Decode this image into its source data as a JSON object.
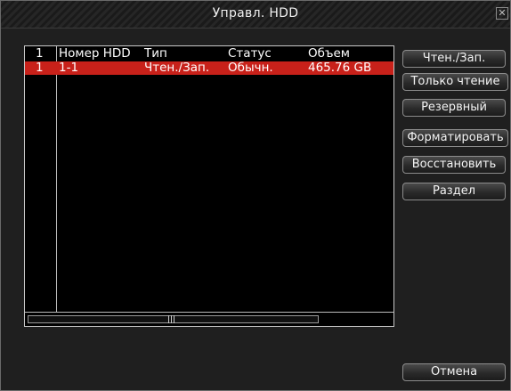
{
  "window": {
    "title": "Управл. HDD",
    "close_glyph": "✕"
  },
  "list": {
    "columns": [
      "1",
      "Номер HDD",
      "Тип",
      "Статус",
      "Объем"
    ],
    "rows": [
      [
        "1",
        "1-1",
        "Чтен./Зап.",
        "Обычн.",
        "465.76 GB"
      ]
    ]
  },
  "actions": {
    "read_write": "Чтен./Зап.",
    "read_only": "Только чтение",
    "backup": "Резервный",
    "format": "Форматировать",
    "restore": "Восстановить",
    "partition": "Раздел",
    "cancel": "Отмена"
  },
  "colors": {
    "selected_row": "#c8211a",
    "background": "#1f1f1f"
  },
  "icons": {
    "close": "close-icon"
  }
}
